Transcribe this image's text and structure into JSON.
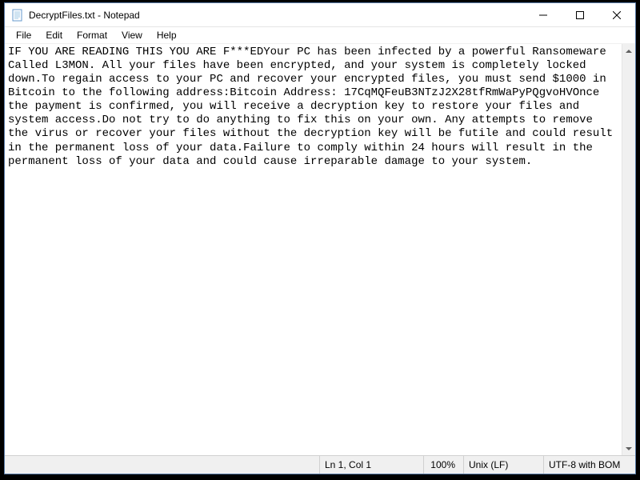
{
  "window": {
    "title": "DecryptFiles.txt - Notepad"
  },
  "menubar": {
    "items": [
      "File",
      "Edit",
      "Format",
      "View",
      "Help"
    ]
  },
  "editor": {
    "content": "IF YOU ARE READING THIS YOU ARE F***EDYour PC has been infected by a powerful Ransomeware Called L3MON. All your files have been encrypted, and your system is completely locked down.To regain access to your PC and recover your encrypted files, you must send $1000 in Bitcoin to the following address:Bitcoin Address: 17CqMQFeuB3NTzJ2X28tfRmWaPyPQgvoHVOnce the payment is confirmed, you will receive a decryption key to restore your files and system access.Do not try to do anything to fix this on your own. Any attempts to remove the virus or recover your files without the decryption key will be futile and could result in the permanent loss of your data.Failure to comply within 24 hours will result in the permanent loss of your data and could cause irreparable damage to your system."
  },
  "statusbar": {
    "position": "Ln 1, Col 1",
    "zoom": "100%",
    "line_ending": "Unix (LF)",
    "encoding": "UTF-8 with BOM"
  }
}
